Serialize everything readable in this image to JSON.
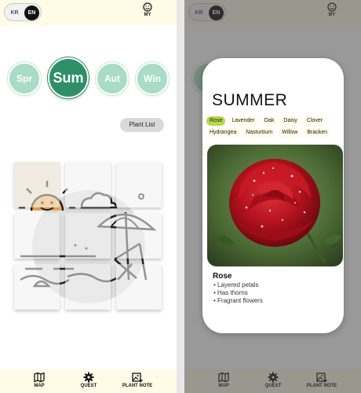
{
  "lang": {
    "kr": "KR",
    "en": "EN"
  },
  "header": {
    "my_label": "MY",
    "my_icon": "smiley-icon"
  },
  "seasons": [
    {
      "label": "Spr",
      "active": false
    },
    {
      "label": "Sum",
      "active": true
    },
    {
      "label": "Aut",
      "active": false
    },
    {
      "label": "Win",
      "active": false
    }
  ],
  "plant_list_label": "Plant List",
  "nav": [
    {
      "label": "MAP",
      "icon": "map-icon"
    },
    {
      "label": "QUEST",
      "icon": "gear-icon"
    },
    {
      "label": "PLANT NOTE",
      "icon": "image-add-icon"
    }
  ],
  "modal": {
    "title": "SUMMER",
    "tags": [
      "Rose",
      "Lavender",
      "Oak",
      "Daisy",
      "Clover",
      "Hydrangea",
      "Nasturtium",
      "Willow",
      "Bracken"
    ],
    "selected_tag": "Rose",
    "plant": {
      "name": "Rose",
      "features": [
        "Layered petals",
        "Has thorns",
        "Fragrant flowers"
      ]
    }
  },
  "colors": {
    "accent_green": "#2f8f68",
    "season_mint": "#a8dcc5",
    "tag_active": "#b6d84a",
    "bar_cream": "#fffbe6"
  }
}
